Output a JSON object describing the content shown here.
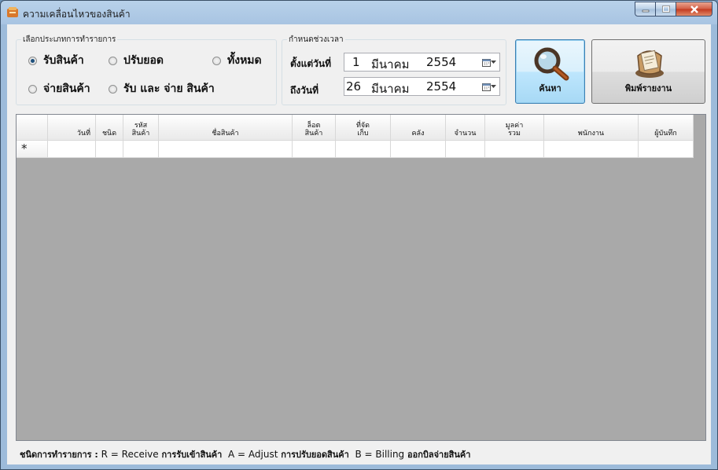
{
  "window": {
    "title": "ความเคลื่อนไหวของสินค้า"
  },
  "transaction_type": {
    "group_title": "เลือกประเภทการทำรายการ",
    "options": [
      {
        "label": "รับสินค้า",
        "selected": true
      },
      {
        "label": "ปรับยอด",
        "selected": false
      },
      {
        "label": "ทั้งหมด",
        "selected": false
      },
      {
        "label": "จ่ายสินค้า",
        "selected": false
      },
      {
        "label": "รับ และ จ่าย สินค้า",
        "selected": false
      }
    ]
  },
  "date_range": {
    "group_title": "กำหนดช่วงเวลา",
    "from_label": "ตั้งแต่วันที่",
    "to_label": "ถึงวันที่",
    "from": {
      "day": "1",
      "month": "มีนาคม",
      "year": "2554"
    },
    "to": {
      "day": "26",
      "month": "มีนาคม",
      "year": "2554"
    }
  },
  "buttons": {
    "search": "ค้นหา",
    "print": "พิมพ์รายงาน"
  },
  "grid": {
    "columns": [
      {
        "label": "วันที่"
      },
      {
        "label": "ชนิด"
      },
      {
        "label": "รหัส\nสินค้า"
      },
      {
        "label": "ชื่อสินค้า"
      },
      {
        "label": "ล็อต\nสินค้า"
      },
      {
        "label": "ที่จัด\nเก็บ"
      },
      {
        "label": "คลัง"
      },
      {
        "label": "จำนวน"
      },
      {
        "label": "มูลค่า\nรวม"
      },
      {
        "label": "พนักงาน"
      },
      {
        "label": "ผู้บันทึก"
      }
    ],
    "new_row_marker": "*"
  },
  "legend": {
    "prefix": "ชนิดการทำรายการ :",
    "r_code": "R = Receive",
    "r_desc": "การรับเข้าสินค้า",
    "a_code": "A = Adjust",
    "a_desc": "การปรับยอดสินค้า",
    "b_code": "B = Billing",
    "b_desc": "ออกบิลจ่ายสินค้า"
  },
  "colors": {
    "titlebar": "#a8c4e2",
    "grid_bg": "#a9a9a9",
    "close_button": "#c3391e",
    "focus_border": "#3c7fb1"
  }
}
